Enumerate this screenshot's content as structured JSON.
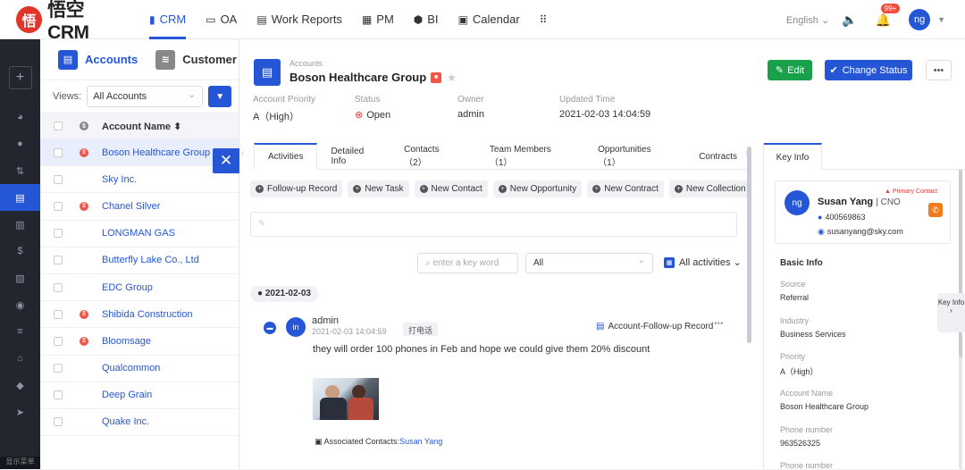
{
  "app": {
    "logo_glyph": "悟",
    "logo_text": "悟空CRM"
  },
  "nav": [
    {
      "icon": "▮",
      "label": "CRM",
      "active": true
    },
    {
      "icon": "▭",
      "label": "OA"
    },
    {
      "icon": "▤",
      "label": "Work Reports"
    },
    {
      "icon": "▦",
      "label": "PM"
    },
    {
      "icon": "⬢",
      "label": "BI"
    },
    {
      "icon": "▣",
      "label": "Calendar"
    },
    {
      "icon": "⠿",
      "label": ""
    }
  ],
  "topbar": {
    "language": "English ⌄",
    "notif_badge": "99+",
    "user_initials": "ng"
  },
  "sidebar_bottom": "显示菜单",
  "list": {
    "tabs": [
      {
        "label": "Accounts"
      },
      {
        "label": "Customer"
      }
    ],
    "views_label": "Views:",
    "views_value": "All Accounts",
    "col_account_name": "Account Name ⬍",
    "rows": [
      {
        "name": "Boson Healthcare Group",
        "flag": true
      },
      {
        "name": "Sky Inc.",
        "flag": false
      },
      {
        "name": "Chanel Silver",
        "flag": true
      },
      {
        "name": "LONGMAN GAS",
        "flag": false
      },
      {
        "name": "Butterfly Lake Co., Ltd",
        "flag": false
      },
      {
        "name": "EDC Group",
        "flag": false
      },
      {
        "name": "Shibida Construction",
        "flag": true
      },
      {
        "name": "Bloomsage",
        "flag": true
      },
      {
        "name": "Qualcommon",
        "flag": false
      },
      {
        "name": "Deep Grain",
        "flag": false
      },
      {
        "name": "Quake Inc.",
        "flag": false
      }
    ]
  },
  "detail": {
    "subtitle": "Accounts",
    "title": "Boson Healthcare Group",
    "edit_label": "Edit",
    "status_label": "Change Status",
    "more_label": "•••",
    "fields": {
      "priority_label": "Account Priority",
      "priority_value": "A（High）",
      "status_label": "Status",
      "status_value": "Open",
      "owner_label": "Owner",
      "owner_value": "admin",
      "updated_label": "Updated Time",
      "updated_value": "2021-02-03 14:04:59"
    },
    "tabs": [
      "Activities",
      "Detailed Info",
      "Contacts （2）",
      "Team Members （1）",
      "Opportunities （1）",
      "Contracts"
    ],
    "actions": [
      "Follow-up Record",
      "New Task",
      "New Contact",
      "New Opportunity",
      "New Contract",
      "New Collection"
    ],
    "search_placeholder": "enter a key word",
    "filter_value": "All",
    "all_activities": "All activities ⌄",
    "date": "2021-02-03",
    "event": {
      "initials": "in",
      "user": "admin",
      "time": "2021-02-03 14:04:59",
      "tag": "打电话",
      "type": "Account-Follow-up Record",
      "text": "they will order 100 phones in Feb and hope we could give them 20% discount",
      "assoc_label": "Associated Contacts:",
      "assoc_contact": "Susan Yang"
    }
  },
  "keyinfo": {
    "tab": "Key Info",
    "contact": {
      "initials": "ng",
      "name": "Susan Yang",
      "role": "| CNO",
      "badge": "Primary Contact",
      "phone": "400569863",
      "email": "susanyang@sky.com"
    },
    "basic_title": "Basic Info",
    "items": [
      {
        "k": "Source",
        "v": "Referral"
      },
      {
        "k": "Industry",
        "v": "Business Services"
      },
      {
        "k": "Priority",
        "v": "A（High）"
      },
      {
        "k": "Account Name",
        "v": "Boson Healthcare Group"
      },
      {
        "k": "Phone number",
        "v": "963526325"
      },
      {
        "k": "Phone number",
        "v": ""
      }
    ],
    "side_tab": "Key Info"
  }
}
